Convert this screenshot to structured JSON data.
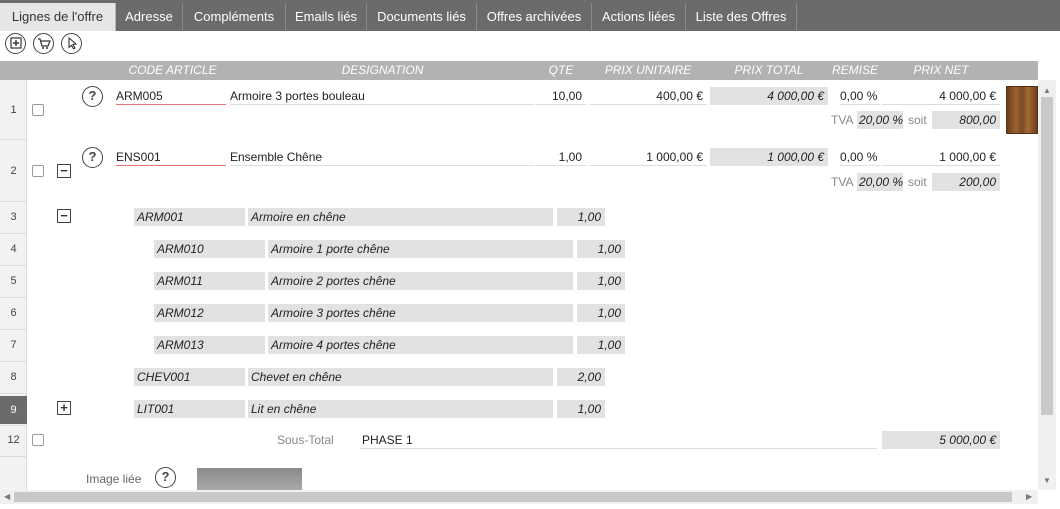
{
  "tabs": [
    {
      "label": "Lignes de l'offre",
      "active": true
    },
    {
      "label": "Adresse"
    },
    {
      "label": "Compléments"
    },
    {
      "label": "Emails liés"
    },
    {
      "label": "Documents liés"
    },
    {
      "label": "Offres archivées"
    },
    {
      "label": "Actions liées"
    },
    {
      "label": "Liste des Offres"
    }
  ],
  "toolbar": {
    "add_icon": "add-line-icon",
    "cart_icon": "cart-icon",
    "select_icon": "cursor-icon"
  },
  "header": {
    "code": "CODE ARTICLE",
    "designation": "DESIGNATION",
    "qte": "QTE",
    "prix_unitaire": "PRIX UNITAIRE",
    "prix_total": "PRIX TOTAL",
    "remise": "REMISE",
    "prix_net": "PRIX NET"
  },
  "rows": {
    "r1": {
      "num": "1",
      "code": "ARM005",
      "designation": "Armoire 3 portes bouleau",
      "qte": "10,00",
      "pu": "400,00 €",
      "total": "4 000,00 €",
      "remise": "0,00 %",
      "net": "4 000,00 €",
      "tva_label": "TVA",
      "tva": "20,00 %",
      "soit_label": "soit",
      "tva_amount": "800,00"
    },
    "r2": {
      "num": "2",
      "code": "ENS001",
      "designation": "Ensemble Chêne",
      "qte": "1,00",
      "pu": "1 000,00 €",
      "total": "1 000,00 €",
      "remise": "0,00 %",
      "net": "1 000,00 €",
      "tva_label": "TVA",
      "tva": "20,00 %",
      "soit_label": "soit",
      "tva_amount": "200,00"
    },
    "r3": {
      "num": "3",
      "code": "ARM001",
      "designation": "Armoire en chêne",
      "qte": "1,00"
    },
    "r4": {
      "num": "4",
      "code": "ARM010",
      "designation": "Armoire 1 porte chêne",
      "qte": "1,00"
    },
    "r5": {
      "num": "5",
      "code": "ARM011",
      "designation": "Armoire 2 portes chêne",
      "qte": "1,00"
    },
    "r6": {
      "num": "6",
      "code": "ARM012",
      "designation": "Armoire 3 portes chêne",
      "qte": "1,00"
    },
    "r7": {
      "num": "7",
      "code": "ARM013",
      "designation": "Armoire 4 portes chêne",
      "qte": "1,00"
    },
    "r8": {
      "num": "8",
      "code": "CHEV001",
      "designation": "Chevet en chêne",
      "qte": "2,00"
    },
    "r9": {
      "num": "9",
      "code": "LIT001",
      "designation": "Lit en chêne",
      "qte": "1,00"
    },
    "r12": {
      "num": "12",
      "label": "Sous-Total",
      "phase": "PHASE 1",
      "amount": "5 000,00 €"
    }
  },
  "linked_image": {
    "label": "Image liée"
  },
  "help_glyph": "?",
  "expand_glyph": "+",
  "collapse_glyph": "−"
}
